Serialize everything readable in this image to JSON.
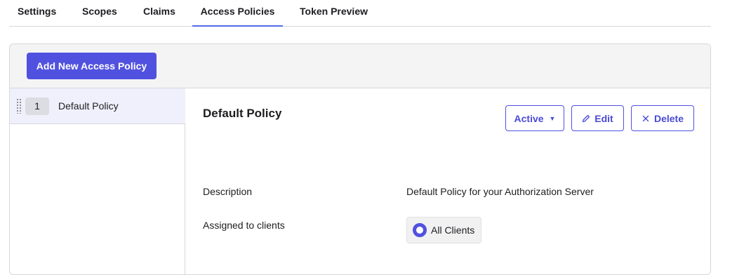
{
  "tabs": [
    {
      "label": "Settings"
    },
    {
      "label": "Scopes"
    },
    {
      "label": "Claims"
    },
    {
      "label": "Access Policies",
      "active": true
    },
    {
      "label": "Token Preview"
    }
  ],
  "toolbar": {
    "add_label": "Add New Access Policy"
  },
  "policies": [
    {
      "priority": "1",
      "name": "Default Policy"
    }
  ],
  "detail": {
    "title": "Default Policy",
    "status_label": "Active",
    "edit_label": "Edit",
    "delete_label": "Delete",
    "description_label": "Description",
    "description_value": "Default Policy for your Authorization Server",
    "assigned_label": "Assigned to clients",
    "assigned_value": "All Clients"
  },
  "colors": {
    "accent": "#5151e0",
    "header_bg": "#f4f4f5",
    "selected_bg": "#f0f0fc"
  },
  "icons": {
    "status_caret": "caret-down-icon",
    "edit": "pencil-icon",
    "delete": "close-icon",
    "drag": "drag-handle-icon"
  }
}
